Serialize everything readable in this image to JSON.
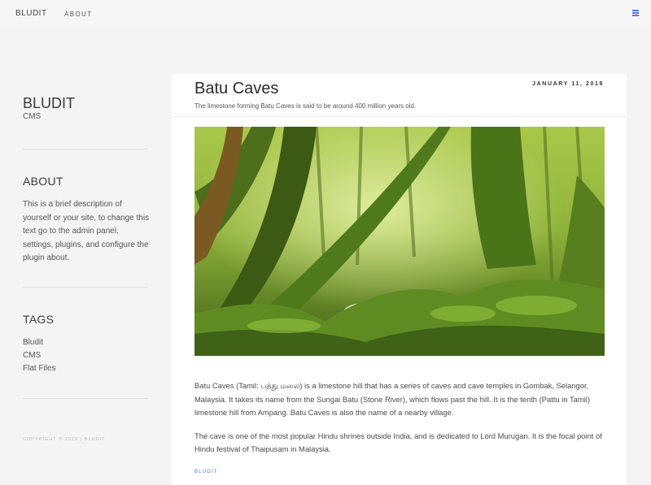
{
  "topnav": {
    "brand": "BLUDIT",
    "links": [
      "ABOUT"
    ],
    "menu_icon": "hamburger-menu-icon",
    "accent_color": "#4a7bd8"
  },
  "sidebar": {
    "title": "BLUDIT",
    "subtitle": "CMS",
    "about": {
      "heading": "ABOUT",
      "text": "This is a brief description of yourself or your site, to change this text go to the admin panel, settings, plugins, and configure the plugin about."
    },
    "tags": {
      "heading": "TAGS",
      "items": [
        "Bludit",
        "CMS",
        "Flat Files"
      ]
    },
    "copyright": "COPYRIGHT © 2018 | BLUDIT"
  },
  "post": {
    "title": "Batu Caves",
    "date": "JANUARY 11, 2018",
    "description": "The limestone forming Batu Caves is said to be around 400 million years old.",
    "paragraphs": [
      "Batu Caves (Tamil: பத்து மலை) is a limestone hill that has a series of caves and cave temples in Gombak, Selangor, Malaysia. It takes its name from the Sungai Batu (Stone River), which flows past the hill. It is the tenth (Pattu in Tamil) limestone hill from Ampang. Batu Caves is also the name of a nearby village.",
      "The cave is one of the most popular Hindu shrines outside India, and is dedicated to Lord Murugan. It is the focal point of Hindu festival of Thaipusam in Malaysia."
    ],
    "tag": "BLUDIT"
  }
}
